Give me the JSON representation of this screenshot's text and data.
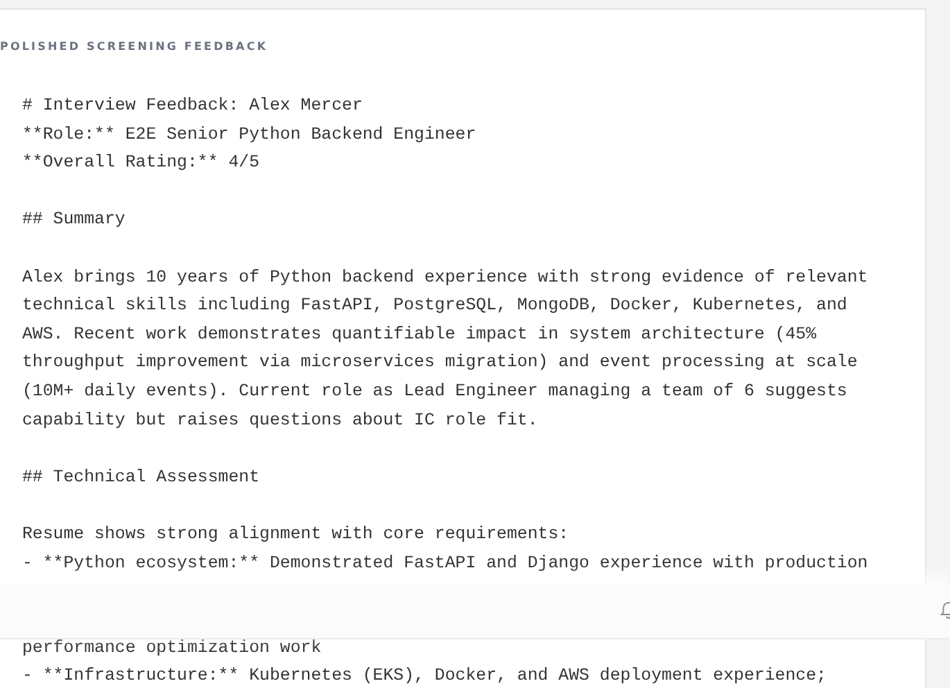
{
  "panel": {
    "heading": "POLISHED SCREENING FEEDBACK",
    "blocks": [
      {
        "kind": "text",
        "lines": [
          "# Interview Feedback: Alex Mercer",
          "**Role:** E2E Senior Python Backend Engineer",
          "**Overall Rating:** 4/5"
        ]
      },
      {
        "kind": "text",
        "lines": [
          "## Summary"
        ]
      },
      {
        "kind": "text",
        "lines": [
          "Alex brings 10 years of Python backend experience with strong evidence of relevant",
          "technical skills including FastAPI, PostgreSQL, MongoDB, Docker, Kubernetes, and",
          "AWS. Recent work demonstrates quantifiable impact in system architecture (45%",
          "throughput improvement via microservices migration) and event processing at scale",
          "(10M+ daily events). Current role as Lead Engineer managing a team of 6 suggests",
          "capability but raises questions about IC role fit."
        ]
      },
      {
        "kind": "text",
        "lines": [
          "## Technical Assessment"
        ]
      },
      {
        "kind": "text",
        "lines": [
          "Resume shows strong alignment with core requirements:",
          "- **Python ecosystem:** Demonstrated FastAPI and Django experience with production"
        ]
      },
      {
        "kind": "overlay"
      },
      {
        "kind": "continuation",
        "lines": [
          "performance optimization work",
          "- **Infrastructure:** Kubernetes (EKS), Docker, and AWS deployment experience;"
        ]
      }
    ]
  }
}
